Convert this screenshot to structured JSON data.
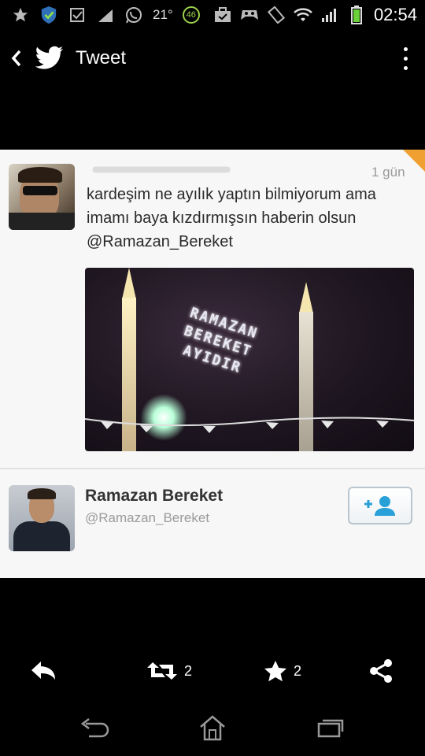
{
  "status_bar": {
    "left_icons": [
      "star-icon",
      "shield-icon",
      "checkbox-icon",
      "signal-icon",
      "whatsapp-icon"
    ],
    "temperature": "21°",
    "badge": "46",
    "right_icons": [
      "briefcase-icon",
      "game-controller-icon",
      "screen-rotation-icon",
      "wifi-icon",
      "cell-signal-icon",
      "battery-icon"
    ],
    "time": "02:54",
    "battery_color": "#6bd13a"
  },
  "app_bar": {
    "title": "Tweet",
    "logo_icon": "twitter-bird-icon",
    "back_icon": "chevron-left-icon",
    "menu_icon": "overflow-menu-icon"
  },
  "tweet": {
    "time": "1 gün",
    "text": "kardeşim ne ayılık yaptın bilmiyorum ama imamı baya kızdırmışsın haberin olsun @Ramazan_Bereket",
    "media_lights_text": [
      "RAMAZAN",
      "BEREKET",
      "AYIDIR"
    ]
  },
  "user_card": {
    "name": "Ramazan Bereket",
    "handle": "@Ramazan_Bereket",
    "follow_icon": "add-user-icon",
    "follow_color": "#2aa0d8"
  },
  "actions": {
    "reply_icon": "reply-icon",
    "retweet_icon": "retweet-icon",
    "retweet_count": "2",
    "favorite_icon": "star-icon",
    "favorite_count": "2",
    "share_icon": "share-icon"
  },
  "nav_bar": {
    "back_icon": "back-arrow-icon",
    "home_icon": "home-icon",
    "recents_icon": "recent-apps-icon"
  }
}
